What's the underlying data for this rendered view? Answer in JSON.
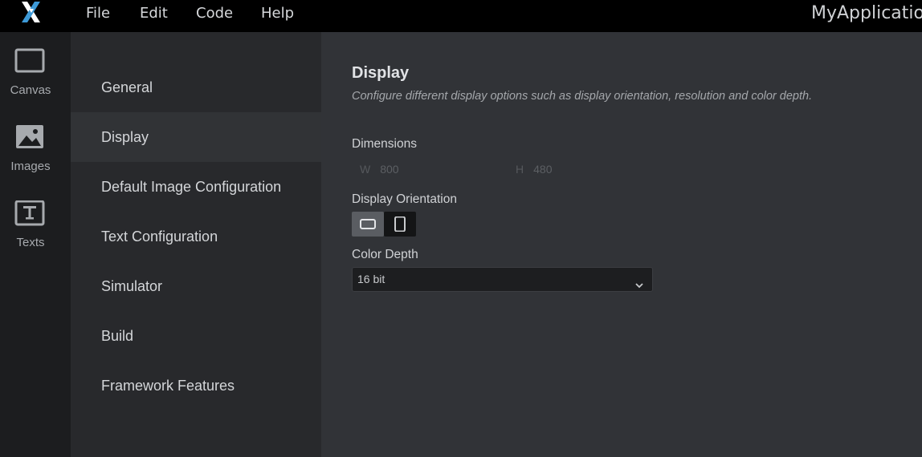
{
  "menu": {
    "items": [
      "File",
      "Edit",
      "Code",
      "Help"
    ],
    "app_title": "MyApplication"
  },
  "rail": {
    "items": [
      {
        "label": "Canvas",
        "icon": "canvas-icon"
      },
      {
        "label": "Images",
        "icon": "image-icon"
      },
      {
        "label": "Texts",
        "icon": "text-icon"
      }
    ]
  },
  "nav": {
    "items": [
      "General",
      "Display",
      "Default Image Configuration",
      "Text Configuration",
      "Simulator",
      "Build",
      "Framework Features"
    ],
    "active": "Display"
  },
  "content": {
    "title": "Display",
    "description": "Configure different display options such as display orientation, resolution and color depth.",
    "dimensions": {
      "label": "Dimensions",
      "width_prefix": "W",
      "width_value": "800",
      "height_prefix": "H",
      "height_value": "480"
    },
    "orientation": {
      "label": "Display Orientation",
      "selected": "landscape"
    },
    "color_depth": {
      "label": "Color Depth",
      "value": "16 bit"
    }
  },
  "colors": {
    "accent_logo": "#3d9ad8",
    "background": "#313337",
    "nav_background": "#28292c",
    "rail_background": "#1c1d1f"
  }
}
